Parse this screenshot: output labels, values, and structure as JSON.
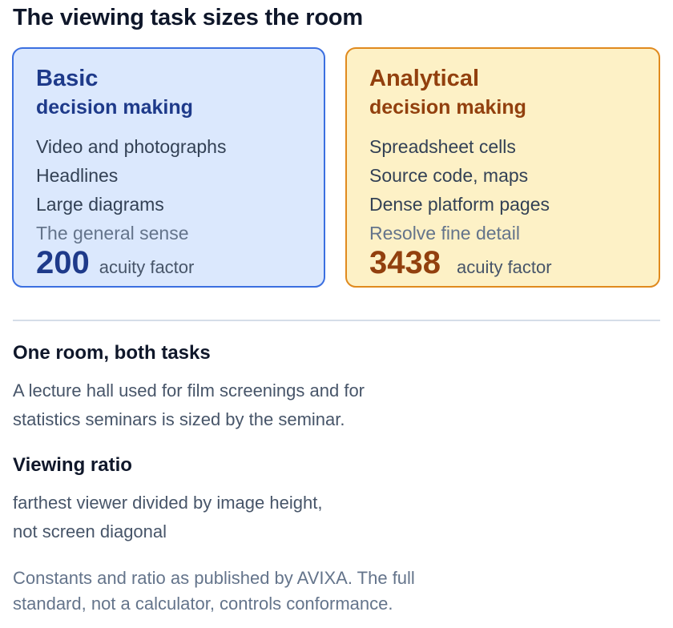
{
  "title": "The viewing task sizes the room",
  "cards": {
    "basic": {
      "title": "Basic",
      "subtitle": "decision making",
      "items": [
        "Video and photographs",
        "Headlines",
        "Large diagrams"
      ],
      "note": "The general sense",
      "factor_value": "200",
      "factor_label": "acuity factor",
      "colors": {
        "background": "#dbe8fd",
        "border": "#3b6fe0",
        "accent": "#1e3a8a"
      }
    },
    "analytical": {
      "title": "Analytical",
      "subtitle": "decision making",
      "items": [
        "Spreadsheet cells",
        "Source code, maps",
        "Dense platform pages"
      ],
      "note": "Resolve fine detail",
      "factor_value": "3438",
      "factor_label": "acuity factor",
      "colors": {
        "background": "#fdf1c6",
        "border": "#e08a1e",
        "accent": "#92400e"
      }
    }
  },
  "sections": [
    {
      "heading": "One room, both tasks",
      "lines": [
        "A lecture hall used for film screenings and for",
        "statistics seminars is sized by the seminar."
      ]
    },
    {
      "heading": "Viewing ratio",
      "lines": [
        "farthest viewer divided by image height,",
        "not screen diagonal"
      ]
    }
  ],
  "footnote": {
    "lines": [
      "Constants and ratio as published by AVIXA. The full",
      "standard, not a calculator, controls conformance."
    ]
  }
}
